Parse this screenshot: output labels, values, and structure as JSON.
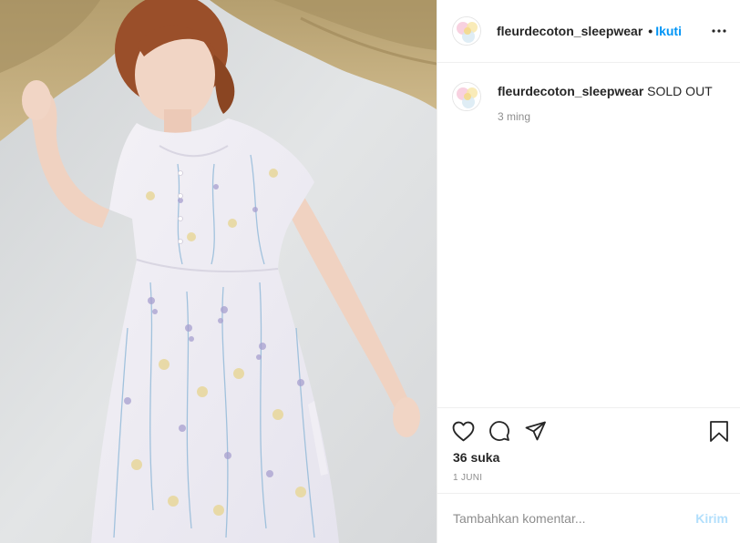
{
  "post": {
    "username": "fleurdecoton_sleepwear",
    "separator": "•",
    "follow_label": "Ikuti",
    "more_icon": "more-horizontal-icon"
  },
  "caption": {
    "username": "fleurdecoton_sleepwear",
    "text": "SOLD OUT",
    "time": "3 ming"
  },
  "actions": {
    "like_icon": "heart-icon",
    "comment_icon": "comment-icon",
    "share_icon": "paper-plane-icon",
    "save_icon": "bookmark-icon",
    "likes": "36 suka",
    "date": "1 JUNI"
  },
  "comment_box": {
    "placeholder": "Tambahkan komentar...",
    "submit_label": "Kirim"
  },
  "colors": {
    "link_blue": "#0095f6",
    "submit_disabled": "#b2dffc",
    "muted_text": "#8e8e8e",
    "divider": "#efefef"
  }
}
